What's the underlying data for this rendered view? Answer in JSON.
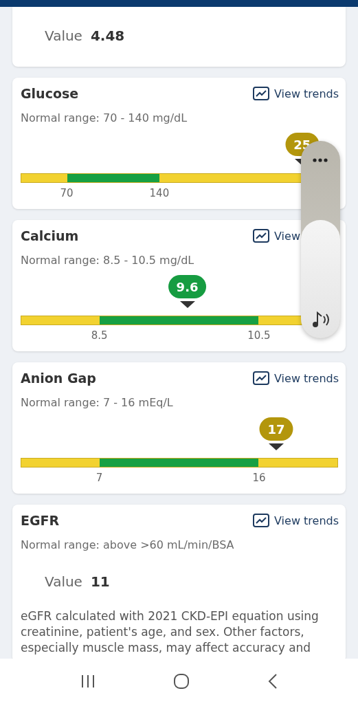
{
  "cards": [
    {
      "kind": "value",
      "value_label": "Value",
      "value": "4.48"
    },
    {
      "kind": "gauge",
      "title": "Glucose",
      "link": "View trends",
      "range": "Normal range: 70 - 140 mg/dL",
      "bar": {
        "color": "#f2d230",
        "fills": [
          {
            "color": "#17a043",
            "level": 0.437
          },
          {
            "color": "#f2d230",
            "level": 0.145
          }
        ]
      },
      "ticks": [
        "70",
        "140"
      ],
      "marker": {
        "value": "25",
        "level": 0.887,
        "color": "#b3960c"
      }
    },
    {
      "kind": "gauge",
      "title": "Calcium",
      "link": "View",
      "range": "Normal range: 8.5 - 10.5 mg/dL",
      "bar": {
        "color": "#f2d230",
        "fills": [
          {
            "color": "#17a043",
            "level": 0.751
          },
          {
            "color": "#f2d230",
            "level": 0.248
          }
        ]
      },
      "ticks": [
        "8.5",
        "10.5"
      ],
      "marker": {
        "value": "9.6",
        "level": 0.525,
        "color": "#169c41"
      }
    },
    {
      "kind": "gauge",
      "title": "Anion Gap",
      "link": "View trends",
      "range": "Normal range: 7 - 16 mEq/L",
      "bar": {
        "color": "#f2d230",
        "fills": [
          {
            "color": "#17a043",
            "level": 0.751
          },
          {
            "color": "#f2d230",
            "level": 0.248
          }
        ]
      },
      "ticks": [
        "7",
        "16"
      ],
      "marker": {
        "value": "17",
        "level": 0.805,
        "color": "#b3960c"
      }
    },
    {
      "kind": "note",
      "title": "EGFR",
      "link": "View trends",
      "range": "Normal range: above >60 mL/min/BSA",
      "value_label": "Value",
      "value": "11",
      "note": "eGFR calculated with 2021 CKD-EPI equation using creatinine, patient's age, and sex. Other factors, especially muscle mass, may affect accuracy and"
    }
  ],
  "volume": {
    "level": 0.6
  }
}
